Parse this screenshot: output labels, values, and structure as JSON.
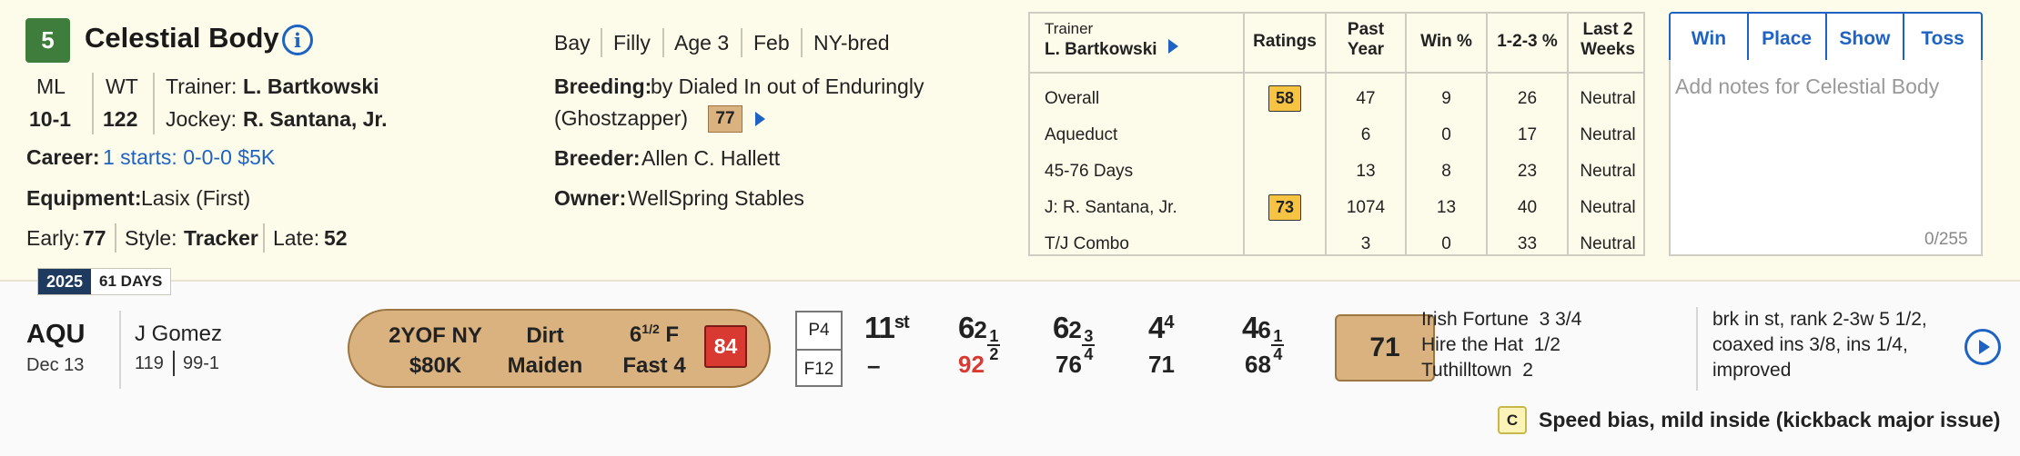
{
  "horse": {
    "number": "5",
    "name": "Celestial Body",
    "ml_label": "ML",
    "ml_value": "10-1",
    "wt_label": "WT",
    "wt_value": "122",
    "trainer_label": "Trainer:",
    "trainer": "L. Bartkowski",
    "jockey_label": "Jockey:",
    "jockey": "R. Santana, Jr.",
    "career_label": "Career:",
    "career": "1 starts: 0-0-0 $5K",
    "equipment_label": "Equipment:",
    "equipment": "Lasix (First)",
    "early_label": "Early:",
    "early": "77",
    "style_label": "Style:",
    "style": "Tracker",
    "late_label": "Late:",
    "late": "52",
    "color": "Bay",
    "sex": "Filly",
    "age": "Age 3",
    "month": "Feb",
    "bred": "NY-bred",
    "breeding_label": "Breeding:",
    "breeding_line1": "by Dialed In out of Enduringly",
    "breeding_line2": "(Ghostzapper)",
    "breeding_rating": "77",
    "breeder_label": "Breeder:",
    "breeder": "Allen C. Hallett",
    "owner_label": "Owner:",
    "owner": "WellSpring Stables"
  },
  "stats_table": {
    "trainer_head_label": "Trainer",
    "trainer_head_name": "L. Bartkowski",
    "headers": [
      "Ratings",
      "Past Year",
      "Win %",
      "1-2-3 %",
      "Last 2 Weeks"
    ],
    "rows": [
      {
        "label": "Overall",
        "rating": "58",
        "past_year": "47",
        "win": "9",
        "itm": "26",
        "last2": "Neutral"
      },
      {
        "label": "Aqueduct",
        "rating": "",
        "past_year": "6",
        "win": "0",
        "itm": "17",
        "last2": "Neutral"
      },
      {
        "label": "45-76 Days",
        "rating": "",
        "past_year": "13",
        "win": "8",
        "itm": "23",
        "last2": "Neutral"
      },
      {
        "label": "J: R. Santana, Jr.",
        "rating": "73",
        "past_year": "1074",
        "win": "13",
        "itm": "40",
        "last2": "Neutral"
      },
      {
        "label": "T/J Combo",
        "rating": "",
        "past_year": "3",
        "win": "0",
        "itm": "33",
        "last2": "Neutral"
      }
    ]
  },
  "bets": [
    "Win",
    "Place",
    "Show",
    "Toss"
  ],
  "notes": {
    "placeholder": "Add notes for Celestial Body",
    "counter": "0/255"
  },
  "year_tag": {
    "year": "2025",
    "days": "61 DAYS"
  },
  "past_race": {
    "track": "AQU",
    "date": "Dec 13",
    "jockey": "J Gomez",
    "weight": "119",
    "odds": "99-1",
    "class_line1": "2YOF NY",
    "class_line2": "$80K",
    "surface": "Dirt",
    "race_type": "Maiden",
    "distance_whole": "6",
    "distance_num": "1",
    "distance_den": "2",
    "distance_unit": "F",
    "condition": "Fast 4",
    "race_rating": "84",
    "post": "P4",
    "field": "F12",
    "start_pos": "11",
    "start_sup": "st",
    "start_sub": "–",
    "calls": [
      {
        "pos": "6",
        "len_whole": "2",
        "len_num": "1",
        "len_den": "2",
        "fig": "92",
        "fig_color": "#d83a31"
      },
      {
        "pos": "6",
        "len_whole": "2",
        "len_num": "3",
        "len_den": "4",
        "fig": "76",
        "fig_color": "#222222"
      },
      {
        "pos": "4",
        "len_whole": "4",
        "len_num": "",
        "len_den": "",
        "fig": "71",
        "fig_color": "#222222"
      },
      {
        "pos": "4",
        "len_whole": "6",
        "len_num": "1",
        "len_den": "4",
        "fig": "68",
        "fig_color": "#222222"
      }
    ],
    "final_fig": "71",
    "finishers": [
      {
        "name": "Irish Fortune",
        "margin": "3 3/4"
      },
      {
        "name": "Hire the Hat",
        "margin": "1/2"
      },
      {
        "name": "Tuthilltown",
        "margin": "2"
      }
    ],
    "comment_lines": [
      "brk in st, rank 2-3w 5 1/2,",
      "coaxed ins 3/8, ins 1/4,",
      "improved"
    ],
    "bias_badge": "C",
    "bias": "Speed bias, mild inside (kickback major issue)"
  }
}
